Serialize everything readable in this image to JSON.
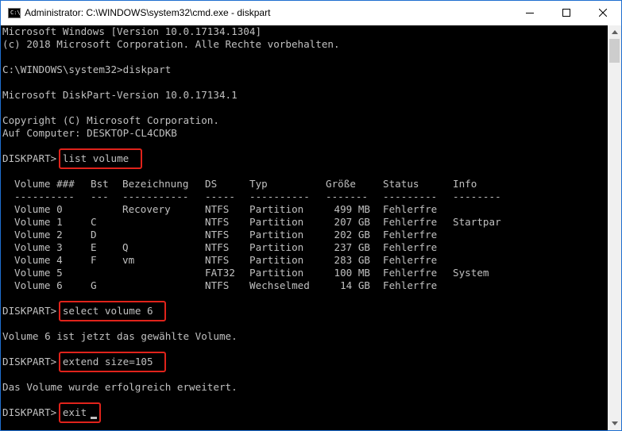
{
  "window": {
    "icon_text": "C:\\",
    "title": "Administrator: C:\\WINDOWS\\system32\\cmd.exe - diskpart",
    "controls": {
      "minimize": "minimize",
      "maximize": "maximize",
      "close": "close"
    }
  },
  "console": {
    "header": [
      "Microsoft Windows [Version 10.0.17134.1304]",
      "(c) 2018 Microsoft Corporation. Alle Rechte vorbehalten."
    ],
    "cmd_prompt": "C:\\WINDOWS\\system32>diskpart",
    "diskpart_version": "Microsoft DiskPart-Version 10.0.17134.1",
    "copyright": "Copyright (C) Microsoft Corporation.",
    "computer": "Auf Computer: DESKTOP-CL4CDKB",
    "prompt": "DISKPART> ",
    "commands": {
      "list": "list volume",
      "select": "select volume 6",
      "extend": "extend size=105",
      "exit": "exit"
    },
    "messages": {
      "selected": "Volume 6 ist jetzt das gewählte Volume.",
      "extended": "Das Volume wurde erfolgreich erweitert."
    }
  },
  "volume_table": {
    "headers": [
      "Volume ###",
      "Bst",
      "Bezeichnung",
      "DS",
      "Typ",
      "Größe",
      "Status",
      "Info"
    ],
    "separators": [
      "----------",
      "---",
      "-----------",
      "-----",
      "----------",
      "-------",
      "---------",
      "--------"
    ],
    "rows": [
      [
        "Volume 0",
        "",
        "Recovery",
        "NTFS",
        "Partition",
        "499 MB",
        "Fehlerfre",
        ""
      ],
      [
        "Volume 1",
        "C",
        "",
        "NTFS",
        "Partition",
        "207 GB",
        "Fehlerfre",
        "Startpar"
      ],
      [
        "Volume 2",
        "D",
        "",
        "NTFS",
        "Partition",
        "202 GB",
        "Fehlerfre",
        ""
      ],
      [
        "Volume 3",
        "E",
        "Q",
        "NTFS",
        "Partition",
        "237 GB",
        "Fehlerfre",
        ""
      ],
      [
        "Volume 4",
        "F",
        "vm",
        "NTFS",
        "Partition",
        "283 GB",
        "Fehlerfre",
        ""
      ],
      [
        "Volume 5",
        "",
        "",
        "FAT32",
        "Partition",
        "100 MB",
        "Fehlerfre",
        "System"
      ],
      [
        "Volume 6",
        "G",
        "",
        "NTFS",
        "Wechselmed",
        "14 GB",
        "Fehlerfre",
        ""
      ]
    ]
  },
  "colors": {
    "console_bg": "#000000",
    "console_text": "#c0c0c0",
    "highlight": "#e0231b",
    "window_border": "#1f6fd0"
  }
}
